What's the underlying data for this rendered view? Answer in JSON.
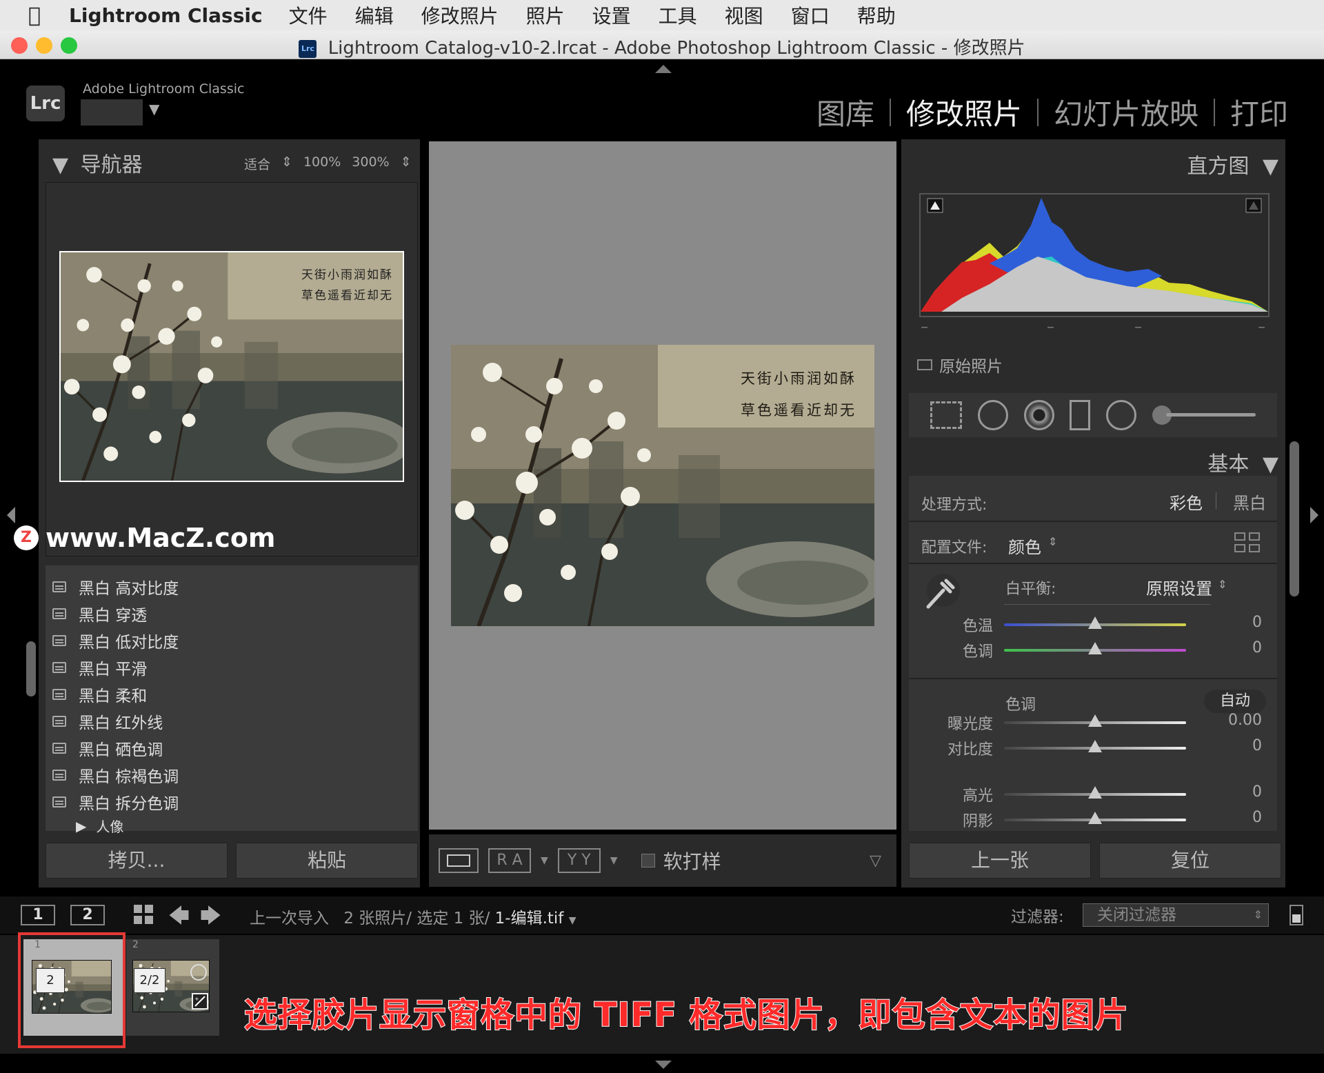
{
  "menubar": {
    "app": "Lightroom Classic",
    "items": [
      "文件",
      "编辑",
      "修改照片",
      "照片",
      "设置",
      "工具",
      "视图",
      "窗口",
      "帮助"
    ]
  },
  "window": {
    "title": "Lightroom Catalog-v10-2.lrcat - Adobe Photoshop Lightroom Classic - 修改照片",
    "cat_icon": "Lrc"
  },
  "header": {
    "logo": "Lrc",
    "brand": "Adobe Lightroom Classic",
    "modules": [
      {
        "label": "图库",
        "active": false
      },
      {
        "label": "修改照片",
        "active": true
      },
      {
        "label": "幻灯片放映",
        "active": false
      },
      {
        "label": "打印",
        "active": false
      }
    ]
  },
  "navigator": {
    "title": "导航器",
    "zoom": [
      "适合",
      "100%",
      "300%"
    ],
    "poem": [
      "天街小雨润如酥",
      "草色遥看近却无"
    ]
  },
  "watermark": {
    "icon": "Z",
    "text": "www.MacZ.com"
  },
  "presets": {
    "items": [
      "黑白 高对比度",
      "黑白 穿透",
      "黑白 低对比度",
      "黑白 平滑",
      "黑白 柔和",
      "黑白 红外线",
      "黑白 硒色调",
      "黑白 棕褐色调",
      "黑白 拆分色调"
    ],
    "group": "人像",
    "copy_label": "拷贝...",
    "paste_label": "粘贴"
  },
  "toolbar": {
    "ra": "R A",
    "yy": "Y Y",
    "softproof": "软打样"
  },
  "right": {
    "histogram_title": "直方图",
    "original_photo": "原始照片",
    "basic_title": "基本",
    "treatment_label": "处理方式:",
    "treatment_color": "彩色",
    "treatment_bw": "黑白",
    "profile_label": "配置文件:",
    "profile_value": "颜色",
    "wb_label": "白平衡:",
    "wb_value": "原照设置",
    "tone_label": "色调",
    "auto_label": "自动",
    "sliders": [
      {
        "label": "色温",
        "value": "0"
      },
      {
        "label": "色调",
        "value": "0"
      },
      {
        "label": "曝光度",
        "value": "0.00"
      },
      {
        "label": "对比度",
        "value": "0"
      },
      {
        "label": "高光",
        "value": "0"
      },
      {
        "label": "阴影",
        "value": "0"
      }
    ],
    "prev_label": "上一张",
    "reset_label": "复位"
  },
  "filmbar": {
    "view1": "1",
    "view2": "2",
    "source": "上一次导入",
    "count": "2 张照片/ 选定 1 张/",
    "current": "1-编辑.tif",
    "filter_label": "过滤器:",
    "filter_value": "关闭过滤器"
  },
  "filmstrip": {
    "frame_numbers": [
      "1",
      "2"
    ],
    "badge1": "2",
    "badge2": "2/2"
  },
  "annotation": "选择胶片显示窗格中的 TIFF 格式图片，即包含文本的图片",
  "colors": {
    "annotation": "#ff2a2a",
    "highlight_box": "#e53935"
  }
}
